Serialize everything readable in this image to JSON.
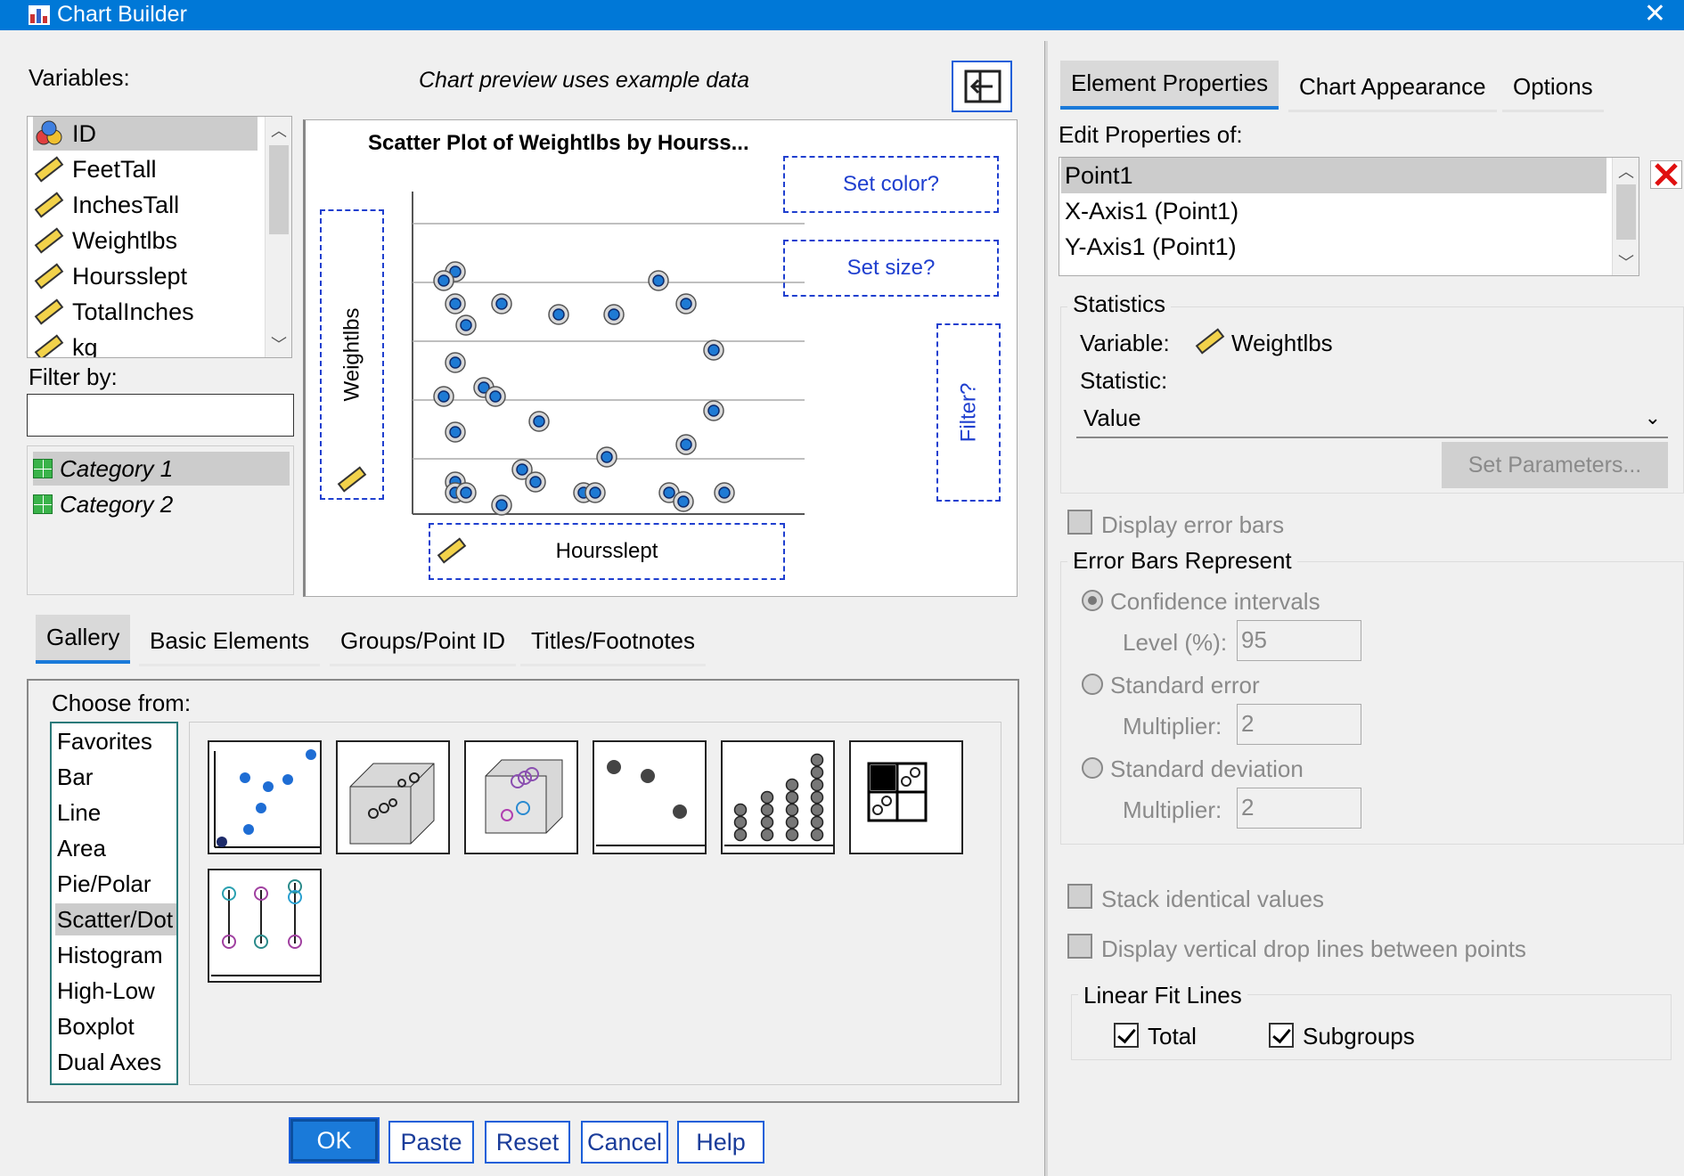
{
  "window": {
    "title": "Chart Builder",
    "close_glyph": "✕"
  },
  "left": {
    "variables_label": "Variables:",
    "preview_note": "Chart preview uses example data",
    "variables": [
      {
        "name": "ID",
        "icon": "nominal-icon"
      },
      {
        "name": "FeetTall",
        "icon": "ruler-icon"
      },
      {
        "name": "InchesTall",
        "icon": "ruler-icon"
      },
      {
        "name": "Weightlbs",
        "icon": "ruler-icon"
      },
      {
        "name": "Hoursslept",
        "icon": "ruler-icon"
      },
      {
        "name": "TotalInches",
        "icon": "ruler-icon"
      },
      {
        "name": "kg",
        "icon": "ruler-icon"
      }
    ],
    "filter_label": "Filter by:",
    "filter_value": "",
    "categories": [
      "Category 1",
      "Category 2"
    ]
  },
  "preview": {
    "title": "Scatter Plot of Weightlbs by Hourss...",
    "y_drop": "Weightlbs",
    "x_drop": "Hoursslept",
    "set_color": "Set color?",
    "set_size": "Set size?",
    "filter": "Filter?"
  },
  "gallery": {
    "tabs": [
      "Gallery",
      "Basic Elements",
      "Groups/Point ID",
      "Titles/Footnotes"
    ],
    "active_tab": "Gallery",
    "choose_label": "Choose from:",
    "choose_items": [
      "Favorites",
      "Bar",
      "Line",
      "Area",
      "Pie/Polar",
      "Scatter/Dot",
      "Histogram",
      "High-Low",
      "Boxplot",
      "Dual Axes"
    ],
    "selected": "Scatter/Dot"
  },
  "buttons": {
    "ok": "OK",
    "paste": "Paste",
    "reset": "Reset",
    "cancel": "Cancel",
    "help": "Help"
  },
  "right": {
    "tabs": [
      "Element Properties",
      "Chart Appearance",
      "Options"
    ],
    "active_tab": "Element Properties",
    "edit_label": "Edit Properties of:",
    "properties": [
      "Point1",
      "X-Axis1 (Point1)",
      "Y-Axis1 (Point1)"
    ],
    "statistics": {
      "group_label": "Statistics",
      "variable_label": "Variable:",
      "variable_value": "Weightlbs",
      "statistic_label": "Statistic:",
      "statistic_value": "Value",
      "set_params": "Set Parameters..."
    },
    "display_error_bars": {
      "label": "Display error bars",
      "checked": false
    },
    "error_bars": {
      "group_label": "Error Bars Represent",
      "confidence": "Confidence intervals",
      "level_label": "Level (%):",
      "level_value": "95",
      "std_error": "Standard error",
      "multiplier_label": "Multiplier:",
      "std_error_mult": "2",
      "std_dev": "Standard deviation",
      "std_dev_mult": "2"
    },
    "stack_identical": {
      "label": "Stack identical values",
      "checked": false
    },
    "drop_lines": {
      "label": "Display vertical drop lines between points",
      "checked": false
    },
    "fit_lines": {
      "group_label": "Linear Fit Lines",
      "total": {
        "label": "Total",
        "checked": true
      },
      "subgroups": {
        "label": "Subgroups",
        "checked": true
      }
    }
  },
  "colors": {
    "titlebar": "#0078d7",
    "accent": "#1a7ad9",
    "dashed": "#1f3fcf",
    "point_fill": "#1e7ad4",
    "close_red": "#e01010"
  }
}
